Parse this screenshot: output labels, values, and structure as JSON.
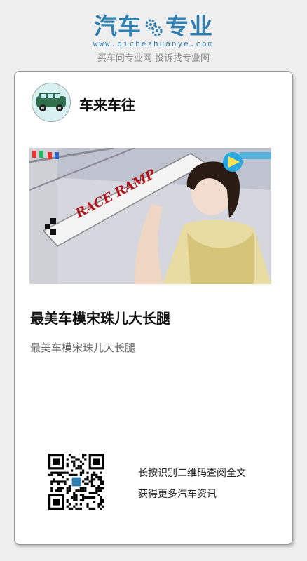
{
  "header": {
    "logo_left": "汽车",
    "logo_right": "专业",
    "domain": "www.qichezhuanye.com",
    "tagline": "买车问专业网 投诉找专业网"
  },
  "card": {
    "account_name": "车来车往",
    "article_title": "最美车模宋珠儿大长腿",
    "article_summary": "最美车模宋珠儿大长腿",
    "cover_banner_text": "RACE RAMP",
    "qr_line1": "长按识别二维码查阅全文",
    "qr_line2": "获得更多汽车资讯"
  },
  "colors": {
    "brand": "#2f7fb1",
    "background": "#efefef"
  },
  "icons": [
    "gear-icon",
    "car-avatar-icon",
    "video-play-icon",
    "qr-code"
  ]
}
